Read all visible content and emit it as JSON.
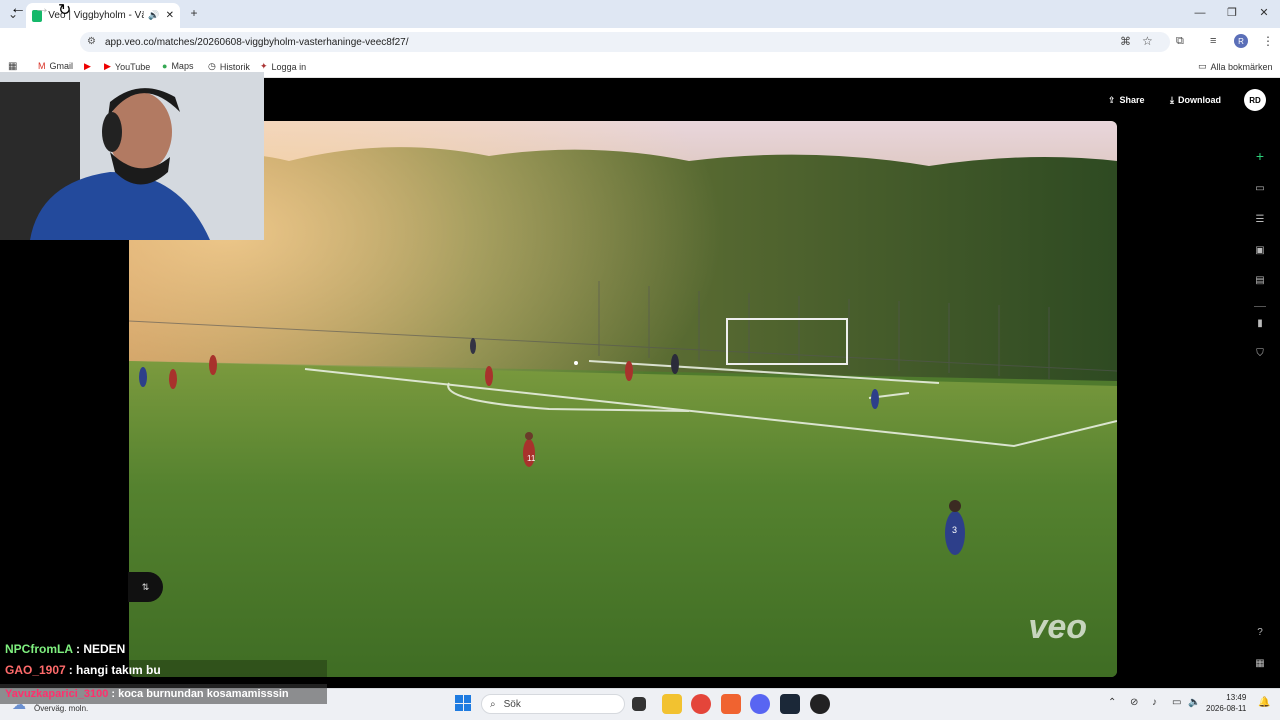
{
  "browser": {
    "tab_title": "Veo | Viggbyholm - Västerh",
    "url": "app.veo.co/matches/20260608-viggbyholm-vasterhaninge-veec8f27/",
    "new_tab_label": "+",
    "bookmarks": [
      "Gmail",
      "YouTube",
      "Maps",
      "Historik",
      "Logga in"
    ],
    "all_bookmarks": "Alla bokmärken"
  },
  "veo": {
    "share_label": "Share",
    "download_label": "Download",
    "avatar_initials": "RD",
    "watermark": "veo"
  },
  "player": {
    "jersey_11": "11",
    "jersey_3": "3"
  },
  "chat": [
    {
      "user": "NPCfromLA",
      "message": "NEDEN",
      "color": "#7ff07f"
    },
    {
      "user": "GAO_1907",
      "message": "hangi takım bu",
      "color": "#ff6b6b"
    },
    {
      "user": "Yavuzkaparici_3100",
      "message": "koca burnundan kosamamisssin",
      "color": "#ff2f6d"
    }
  ],
  "taskbar": {
    "search_placeholder": "Sök",
    "time": "13:49",
    "date": "2026-08-11",
    "weather": "Överväg. moln."
  },
  "colors": {
    "veo_accent": "#2bd07a",
    "pitch_green": "#4f7a2d"
  }
}
